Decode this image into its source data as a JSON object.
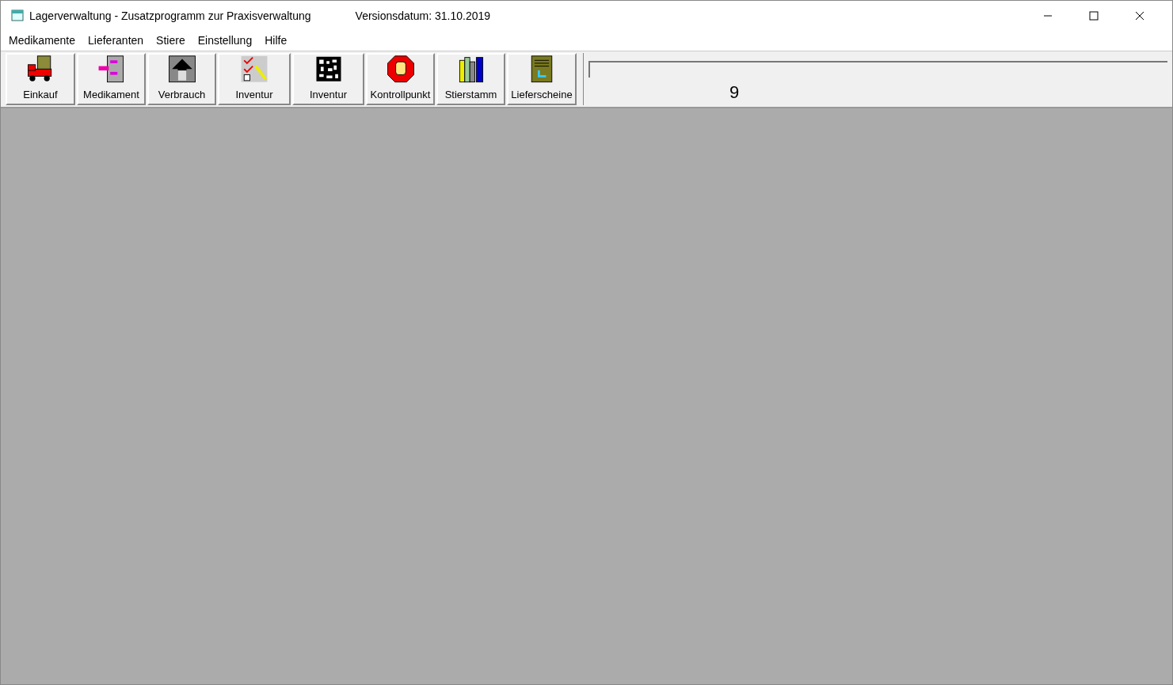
{
  "window": {
    "title": "Lagerverwaltung - Zusatzprogramm zur Praxisverwaltung",
    "version": "Versionsdatum: 31.10.2019"
  },
  "menu": [
    "Medikamente",
    "Lieferanten",
    "Stiere",
    "Einstellung",
    "Hilfe"
  ],
  "toolbar": [
    {
      "label": "Einkauf"
    },
    {
      "label": "Medikament"
    },
    {
      "label": "Verbrauch"
    },
    {
      "label": "Inventur"
    },
    {
      "label": "Inventur"
    },
    {
      "label": "Kontrollpunkt"
    },
    {
      "label": "Stierstamm"
    },
    {
      "label": "Lieferscheine"
    }
  ],
  "progress": {
    "level": 0,
    "reading": "9"
  }
}
